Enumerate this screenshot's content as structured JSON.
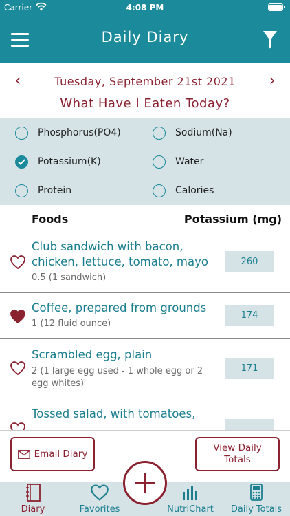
{
  "status_bar": {
    "carrier": "Carrier",
    "time": "4:08 PM"
  },
  "nav": {
    "title": "Daily Diary"
  },
  "date_bar": {
    "date": "Tuesday, September 21st 2021",
    "prev": "‹",
    "next": "›"
  },
  "question": "What Have I Eaten Today?",
  "options": [
    {
      "label": "Phosphorus(PO4)",
      "selected": false
    },
    {
      "label": "Sodium(Na)",
      "selected": false
    },
    {
      "label": "Potassium(K)",
      "selected": true
    },
    {
      "label": "Water",
      "selected": false
    },
    {
      "label": "Protein",
      "selected": false
    },
    {
      "label": "Calories",
      "selected": false
    }
  ],
  "table": {
    "col_foods": "Foods",
    "col_value": "Potassium (mg)",
    "items": [
      {
        "name": "Club sandwich with bacon, chicken, lettuce, tomato, mayo",
        "serving": "0.5 (1 sandwich)",
        "value": "260",
        "favorite": false
      },
      {
        "name": "Coffee, prepared from grounds",
        "serving": "1 (12 fluid ounce)",
        "value": "174",
        "favorite": true
      },
      {
        "name": "Scrambled egg, plain",
        "serving": "2 (1 large egg used - 1 whole egg or 2 egg whites)",
        "value": "171",
        "favorite": false
      },
      {
        "name": "Tossed salad, with tomatoes,",
        "serving": "",
        "value": "",
        "favorite": false
      }
    ]
  },
  "actions": {
    "email": "Email Diary",
    "totals": "View Daily Totals"
  },
  "tabs": [
    {
      "label": "Diary",
      "icon": "diary-icon"
    },
    {
      "label": "Favorites",
      "icon": "heart-icon"
    },
    {
      "label": "NutriChart",
      "icon": "bar-chart-icon"
    },
    {
      "label": "Daily Totals",
      "icon": "calculator-icon"
    }
  ],
  "colors": {
    "teal": "#1b8a9a",
    "maroon": "#8b2230",
    "light": "#d5e3e7"
  }
}
